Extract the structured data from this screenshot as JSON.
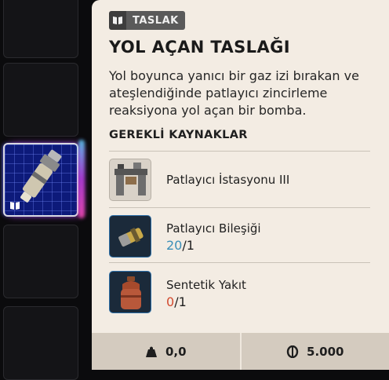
{
  "tooltip": {
    "badge": "TASLAK",
    "title": "YOL AÇAN TASLAĞI",
    "description": "Yol boyunca yanıcı bir gaz izi bırakan ve ateşlendiğinde patlayıcı zincirleme reaksiyona yol açan bir bomba.",
    "requirements_heading": "GEREKLİ KAYNAKLAR",
    "resources": [
      {
        "name": "Patlayıcı İstasyonu III",
        "icon": "workstation-icon"
      },
      {
        "name": "Patlayıcı Bileşiği",
        "have": "20",
        "need": "/1",
        "icon": "explosive-compound-icon"
      },
      {
        "name": "Sentetik Yakıt",
        "have": "0",
        "need": "/1",
        "icon": "fuel-canister-icon"
      }
    ],
    "footer": {
      "weight": "0,0",
      "price": "5.000"
    }
  },
  "inventory": {
    "selected_item_icon": "bomb-blueprint-icon"
  },
  "colors": {
    "panel_bg": "#f3ece3",
    "have_ok": "#3b8fb8",
    "have_bad": "#d24a2f",
    "slot_selected": "#0d1a7a"
  }
}
